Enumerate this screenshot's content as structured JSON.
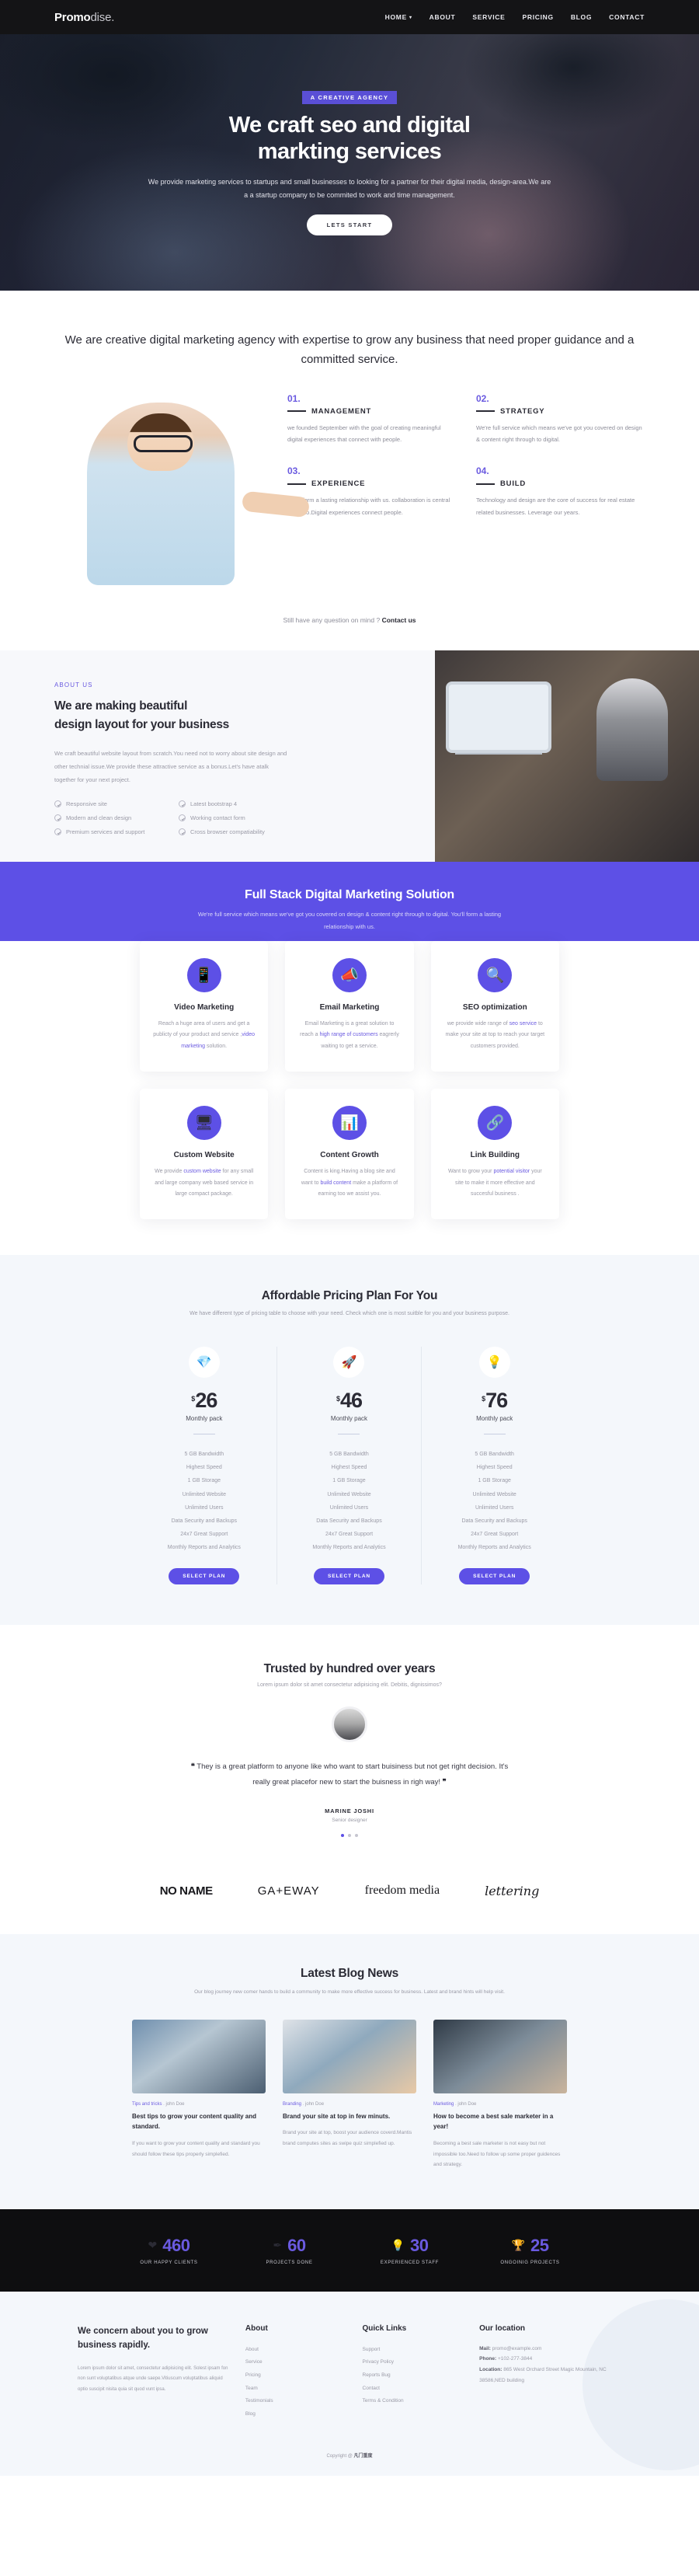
{
  "nav": {
    "logo_bold": "Promo",
    "logo_light": "dise.",
    "links": [
      {
        "label": "HOME",
        "caret": "▾"
      },
      {
        "label": "ABOUT"
      },
      {
        "label": "SERVICE"
      },
      {
        "label": "PRICING"
      },
      {
        "label": "BLOG"
      },
      {
        "label": "CONTACT"
      }
    ]
  },
  "hero": {
    "badge": "A CREATIVE AGENCY",
    "title_line1": "We craft seo and digital",
    "title_line2": "markting services",
    "paragraph": "We provide marketing services to startups and small businesses to looking for a partner for their digital media, design-area.We are a a startup company to be commited to work and time management.",
    "cta": "LETS START"
  },
  "intro": {
    "heading": "We are creative digital marketing agency with expertise to grow any business that need proper guidance and a committed service."
  },
  "features": [
    {
      "num": "01.",
      "title": "MANAGEMENT",
      "desc": "we founded September with the goal of creating meaningful digital experiences that connect with people."
    },
    {
      "num": "02.",
      "title": "STRATEGY",
      "desc": "We're full service which means we've got you covered on design & content right through to digital."
    },
    {
      "num": "03.",
      "title": "EXPERIENCE",
      "desc": "You'll form a lasting relationship with us. collaboration is central to we do.Digital experiences connect people."
    },
    {
      "num": "04.",
      "title": "BUILD",
      "desc": "Technology and design are the core of success for real estate related businesses. Leverage our years."
    }
  ],
  "question": {
    "text": "Still have any question on mind ? ",
    "link": "Contact us"
  },
  "about": {
    "eyebrow": "ABOUT US",
    "title_line1": "We are making beautiful",
    "title_line2": "design layout for your business",
    "paragraph": "We craft beautiful website layout from scratch.You need not to worry about site design and other technial issue.We provide these attractive service as a bonus.Let's have atalk together for your next project.",
    "checks": [
      "Responsive site",
      "Latest bootstrap 4",
      "Modern and clean design",
      "Working contact form",
      "Premium services and support",
      "Cross browser compatiability"
    ]
  },
  "fullstack": {
    "title": "Full Stack Digital Marketing Solution",
    "subtitle": "We're full service which means we've got you covered on design & content right through to digital. You'll form a lasting relationship with us."
  },
  "services_row1": [
    {
      "icon": "📱",
      "title": "Video Marketing",
      "desc_pre": "Reach a huge area of users and get a publicty of your product and service ,",
      "desc_link": "video marketing",
      "desc_post": " solution."
    },
    {
      "icon": "📣",
      "title": "Email Marketing",
      "desc_pre": "Email Marketing is a great solution to reach a ",
      "desc_link": "high range of customers",
      "desc_post": " eagrerly waiting to get a service."
    },
    {
      "icon": "🔍",
      "title": "SEO optimization",
      "desc_pre": "we provide wide range of ",
      "desc_link": "seo service",
      "desc_post": " to make your site at top to reach your target customers provided."
    }
  ],
  "services_row2": [
    {
      "icon": "🖥",
      "title": "Custom Website",
      "desc_pre": "We provide ",
      "desc_link": "custom website",
      "desc_post": " for any small and large company web based service in large compact package."
    },
    {
      "icon": "📊",
      "title": "Content Growth",
      "desc_pre": "Content is king.Having a blog site and want to ",
      "desc_link": "build content",
      "desc_post": " make a platform of earning too we assist you."
    },
    {
      "icon": "🔗",
      "title": "Link Building",
      "desc_pre": "Want to grow your ",
      "desc_link": "potential visitor",
      "desc_post": " your site to make it more effective and succesful business ."
    }
  ],
  "pricing": {
    "title": "Affordable Pricing Plan For You",
    "subtitle": "We have different type of pricing table to choose with your need. Check which one is most suitble for you and your business purpose.",
    "currency": "$",
    "period": "Monthly pack",
    "button": "SELECT PLAN",
    "plans": [
      {
        "icon": "💎",
        "price": "26",
        "features": [
          "5 GB Bandwidth",
          "Highest Speed",
          "1 GB Storage",
          "Unlimited Website",
          "Unlimited Users",
          "Data Security and Backups",
          "24x7 Great Support",
          "Monthly Reports and Analytics"
        ]
      },
      {
        "icon": "🚀",
        "price": "46",
        "features": [
          "5 GB Bandwidth",
          "Highest Speed",
          "1 GB Storage",
          "Unlimited Website",
          "Unlimited Users",
          "Data Security and Backups",
          "24x7 Great Support",
          "Monthly Reports and Analytics"
        ]
      },
      {
        "icon": "💡",
        "price": "76",
        "features": [
          "5 GB Bandwidth",
          "Highest Speed",
          "1 GB Storage",
          "Unlimited Website",
          "Unlimited Users",
          "Data Security and Backups",
          "24x7 Great Support",
          "Monthly Reports and Analytics"
        ]
      }
    ]
  },
  "testimonial": {
    "title": "Trusted by hundred over years",
    "subtitle": "Lorem ipsum dolor sit amet consectetur adipisicing elit. Debitis, dignissimos?",
    "quote_open": "❝",
    "quote": "They is a great platform to anyone like who want to start buisiness but not get right decision. It's really great placefor new to start the buisness in righ way!",
    "quote_close": "❞",
    "name": "MARINE JOSHI",
    "role": "Senior designer"
  },
  "brands": [
    {
      "text": "NO NAME",
      "style": "b1"
    },
    {
      "text": "GA+EWAY",
      "style": "b2"
    },
    {
      "text": "freedom media",
      "style": "b3"
    },
    {
      "text": "lettering",
      "style": "b4"
    }
  ],
  "blog": {
    "title": "Latest Blog News",
    "subtitle": "Our blog journey new comer hands to build a community to make more effective success for business. Latest and brand hints will help visit.",
    "posts": [
      {
        "category": "Tips and tricks",
        "author": "john Doe",
        "title": "Best tips to grow your content quality and standard.",
        "desc": "If you want to grow your content quality and standard you should follow these tips properly simplefied."
      },
      {
        "category": "Branding",
        "author": "john Doe",
        "title": "Brand your site at top in few minuts.",
        "desc": "Brand your site at top, boost your audience coverd.Mantis brand computes sites as swipe quiz simplefied up."
      },
      {
        "category": "Marketing",
        "author": "john Doe",
        "title": "How to become a best sale marketer in a year!",
        "desc": "Becoming a best sale marketer is not easy but not impossible too.Need to follow up some proper guidences and strategy."
      }
    ]
  },
  "stats": [
    {
      "icon": "❤",
      "number": "460",
      "label": "OUR HAPPY CLIENTS"
    },
    {
      "icon": "✒",
      "number": "60",
      "label": "PROJECTS DONE"
    },
    {
      "icon": "💡",
      "number": "30",
      "label": "EXPERIENCED STAFF"
    },
    {
      "icon": "🏆",
      "number": "25",
      "label": "ONGOINIG PROJECTS"
    }
  ],
  "footer": {
    "about_title": "We concern about you to grow business rapidly.",
    "about_text": "Lorem ipsum dolor sit amet, consectetur adipisicing elit. Solest ipsam fon non sunt voluptatibus atque unde saepe.Vitiuscum voluptatibus aliquid optio suscipit nisita quia sit quod vunt ipsa.",
    "about_heading": "About",
    "about_links": [
      "About",
      "Service",
      "Pricing",
      "Team",
      "Testimonials",
      "Blog"
    ],
    "quick_heading": "Quick Links",
    "quick_links": [
      "Support",
      "Privacy Policy",
      "Reports Bug",
      "Contact",
      "Terms & Condition"
    ],
    "location_heading": "Our location",
    "location": [
      {
        "label": "Mail:",
        "value": "promo@example.com"
      },
      {
        "label": "Phone:",
        "value": "+102-277-3844"
      },
      {
        "label": "Location:",
        "value": "865 West Orchard Street Magic Mountain, NC 38586,NED building"
      }
    ],
    "copyright_pre": "Copyright @ ",
    "copyright_brand": "凡门重度"
  }
}
